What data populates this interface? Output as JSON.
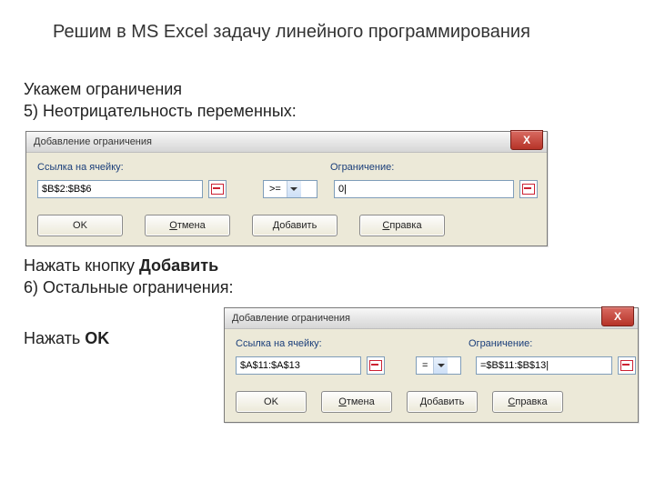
{
  "title": "Решим в MS Excel задачу линейного программирования",
  "block1": {
    "line1": "Укажем ограничения",
    "line2": "5) Неотрицательность переменных:"
  },
  "dialog1": {
    "title": "Добавление ограничения",
    "lbl_cell": "Ссылка на ячейку:",
    "lbl_cons": "Ограничение:",
    "cell_value": "$B$2:$B$6",
    "operator": ">=",
    "cons_value": "0|",
    "btn_ok": "OK",
    "btn_cancel": "Отмена",
    "btn_add": "Добавить",
    "btn_help": "Справка"
  },
  "block2": {
    "line1_pre": "Нажать кнопку ",
    "line1_b": "Добавить",
    "line2": "6) Остальные ограничения:"
  },
  "block3": {
    "pre": "Нажать ",
    "b": "OK"
  },
  "dialog2": {
    "title": "Добавление ограничения",
    "lbl_cell": "Ссылка на ячейку:",
    "lbl_cons": "Ограничение:",
    "cell_value": "$A$11:$A$13",
    "operator": "=",
    "cons_value": "=$B$11:$B$13|",
    "btn_ok": "OK",
    "btn_cancel": "Отмена",
    "btn_add": "Добавить",
    "btn_help": "Справка"
  }
}
